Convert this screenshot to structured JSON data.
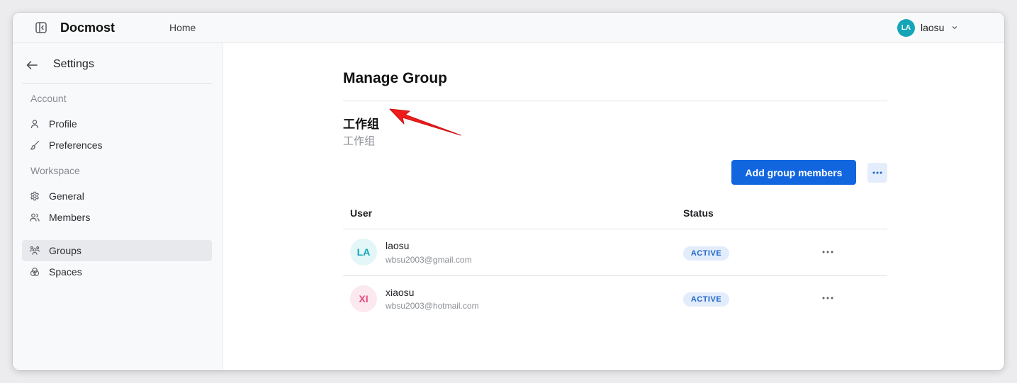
{
  "header": {
    "app_name": "Docmost",
    "nav_home": "Home",
    "user": {
      "initials": "LA",
      "name": "laosu",
      "avatar_color": "#14a5b8"
    }
  },
  "sidebar": {
    "title": "Settings",
    "sections": [
      {
        "label": "Account",
        "items": [
          {
            "label": "Profile",
            "icon": "user-icon"
          },
          {
            "label": "Preferences",
            "icon": "brush-icon"
          }
        ]
      },
      {
        "label": "Workspace",
        "items": [
          {
            "label": "General",
            "icon": "gear-icon"
          },
          {
            "label": "Members",
            "icon": "users-icon"
          },
          {
            "label": "Groups",
            "icon": "group-icon",
            "active": true
          },
          {
            "label": "Spaces",
            "icon": "spaces-icon"
          }
        ]
      }
    ]
  },
  "main": {
    "page_title": "Manage Group",
    "group": {
      "name": "工作组",
      "description": "工作组"
    },
    "add_members_label": "Add group members",
    "table": {
      "columns": [
        "User",
        "Status"
      ],
      "rows": [
        {
          "initials": "LA",
          "name": "laosu",
          "email": "wbsu2003@gmail.com",
          "status": "ACTIVE",
          "avatar_bg": "#e3f6f8",
          "avatar_fg": "#14a5b8"
        },
        {
          "initials": "XI",
          "name": "xiaosu",
          "email": "wbsu2003@hotmail.com",
          "status": "ACTIVE",
          "avatar_bg": "#fce8ef",
          "avatar_fg": "#e64980"
        }
      ]
    }
  },
  "colors": {
    "primary": "#1166e0",
    "annotation_arrow": "#f01c1c"
  }
}
